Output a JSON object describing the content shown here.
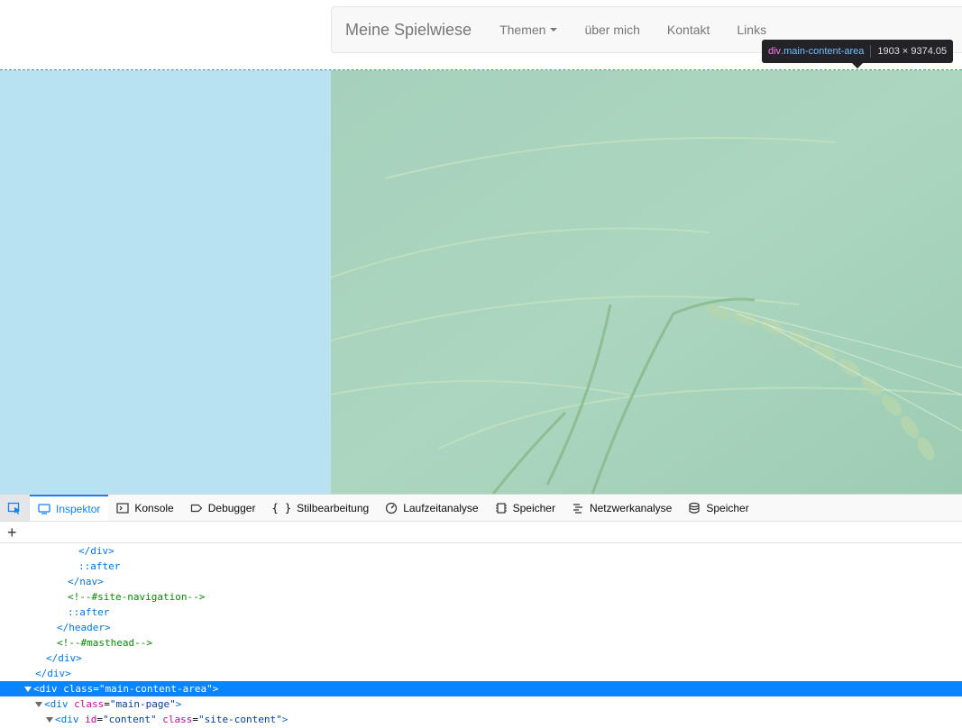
{
  "navbar": {
    "brand": "Meine Spielwiese",
    "items": [
      "Themen",
      "über mich",
      "Kontakt",
      "Links"
    ]
  },
  "tooltip": {
    "tag": "div",
    "class": ".main-content-area",
    "dims": "1903 × 9374.05"
  },
  "devtools": {
    "tabs": [
      "Inspektor",
      "Konsole",
      "Debugger",
      "Stilbearbeitung",
      "Laufzeitanalyse",
      "Speicher",
      "Netzwerkanalyse",
      "Speicher"
    ],
    "active_tab": "Inspektor",
    "add_label": "+",
    "tree": {
      "r0": "</div>",
      "r1": "::after",
      "r2": "</nav>",
      "r3": "<!--#site-navigation-->",
      "r4": "::after",
      "r5": "</header>",
      "r6": "<!--#masthead-->",
      "r7": "</div>",
      "r8": "</div>",
      "r9_open": "<div ",
      "r9_attr": "class",
      "r9_val": "\"main-content-area\"",
      "r9_close": ">",
      "r10_open": "<div ",
      "r10_attr": "class",
      "r10_val": "\"main-page\"",
      "r10_close": ">",
      "r11_open": "<div ",
      "r11_attr1": "id",
      "r11_val1": "\"content\"",
      "r11_attr2": "class",
      "r11_val2": "\"site-content\"",
      "r11_close": ">"
    }
  },
  "colors": {
    "highlight": "#b8e1f1",
    "accent": "#0a84ff",
    "tooltip_bg": "#232327"
  }
}
